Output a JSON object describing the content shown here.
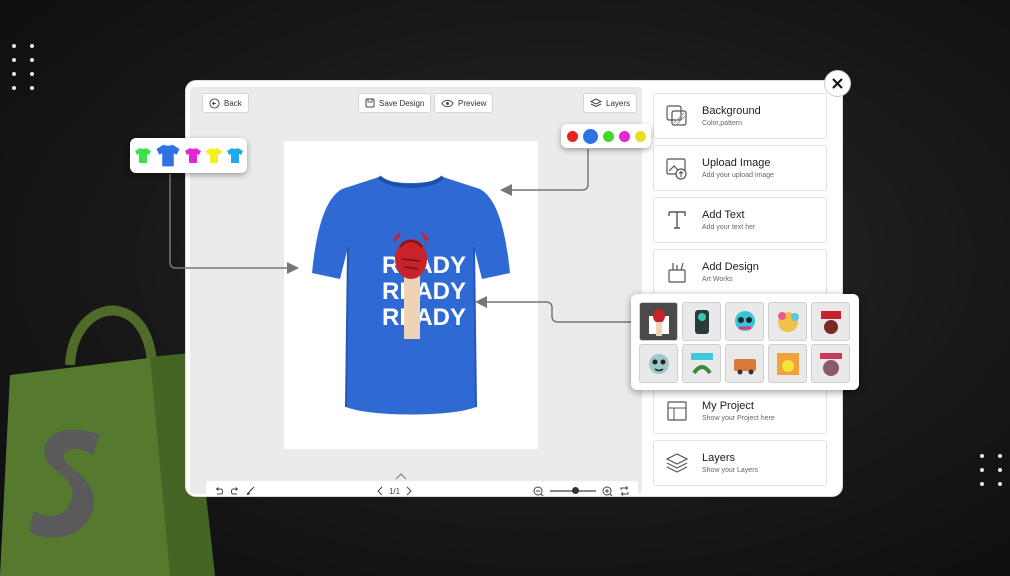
{
  "toolbar": {
    "back_label": "Back",
    "save_label": "Save Design",
    "preview_label": "Preview",
    "layers_label": "Layers"
  },
  "bottom_bar": {
    "page_indicator": "1/1"
  },
  "panel": {
    "items": [
      {
        "title": "Background",
        "subtitle": "Color,pattern",
        "icon": "background-icon"
      },
      {
        "title": "Upload Image",
        "subtitle": "Add your upload image",
        "icon": "upload-image-icon"
      },
      {
        "title": "Add Text",
        "subtitle": "Add your text her",
        "icon": "text-icon"
      },
      {
        "title": "Add Design",
        "subtitle": "Art Works",
        "icon": "design-icon"
      },
      {
        "title": "My Project",
        "subtitle": "Show your Project here",
        "icon": "project-icon"
      },
      {
        "title": "Layers",
        "subtitle": "Show your Layers",
        "icon": "layers-icon"
      }
    ]
  },
  "shirt_colors": [
    "#3ee04a",
    "#2f72e6",
    "#e327d6",
    "#f2f21e",
    "#21a8ea"
  ],
  "selected_shirt_color": "#2f72e6",
  "background_colors": [
    "#e8231e",
    "#2f72e6",
    "#44d62c",
    "#e327d6",
    "#e3e01e"
  ],
  "selected_background_color": "#2f72e6",
  "design_print_text": [
    "READY",
    "READY",
    "READY"
  ],
  "design_thumbnails": 10
}
